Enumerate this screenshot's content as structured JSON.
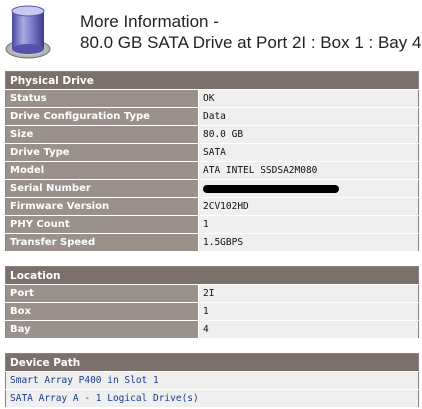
{
  "header": {
    "title_line1": "More Information -",
    "title_line2": "80.0 GB SATA Drive at Port 2I : Box 1 : Bay 4",
    "icon": "database-drive-icon"
  },
  "physical_drive": {
    "section_title": "Physical Drive",
    "rows": [
      {
        "label": "Status",
        "value": "OK"
      },
      {
        "label": "Drive Configuration Type",
        "value": "Data"
      },
      {
        "label": "Size",
        "value": "80.0 GB"
      },
      {
        "label": "Drive Type",
        "value": "SATA"
      },
      {
        "label": "Model",
        "value": "ATA INTEL SSDSA2M080"
      },
      {
        "label": "Serial Number",
        "value": ""
      },
      {
        "label": "Firmware Version",
        "value": "2CV102HD"
      },
      {
        "label": "PHY Count",
        "value": "1"
      },
      {
        "label": "Transfer Speed",
        "value": "1.5GBPS"
      }
    ]
  },
  "location": {
    "section_title": "Location",
    "rows": [
      {
        "label": "Port",
        "value": "2I"
      },
      {
        "label": "Box",
        "value": "1"
      },
      {
        "label": "Bay",
        "value": "4"
      }
    ]
  },
  "device_path": {
    "section_title": "Device Path",
    "links": [
      "Smart Array P400 in Slot 1",
      "SATA Array A - 1 Logical Drive(s)"
    ]
  },
  "colors": {
    "section_header": "#7b706c",
    "label_bg": "#9a908c",
    "value_bg": "#efefef",
    "link": "#1a3a8a"
  }
}
